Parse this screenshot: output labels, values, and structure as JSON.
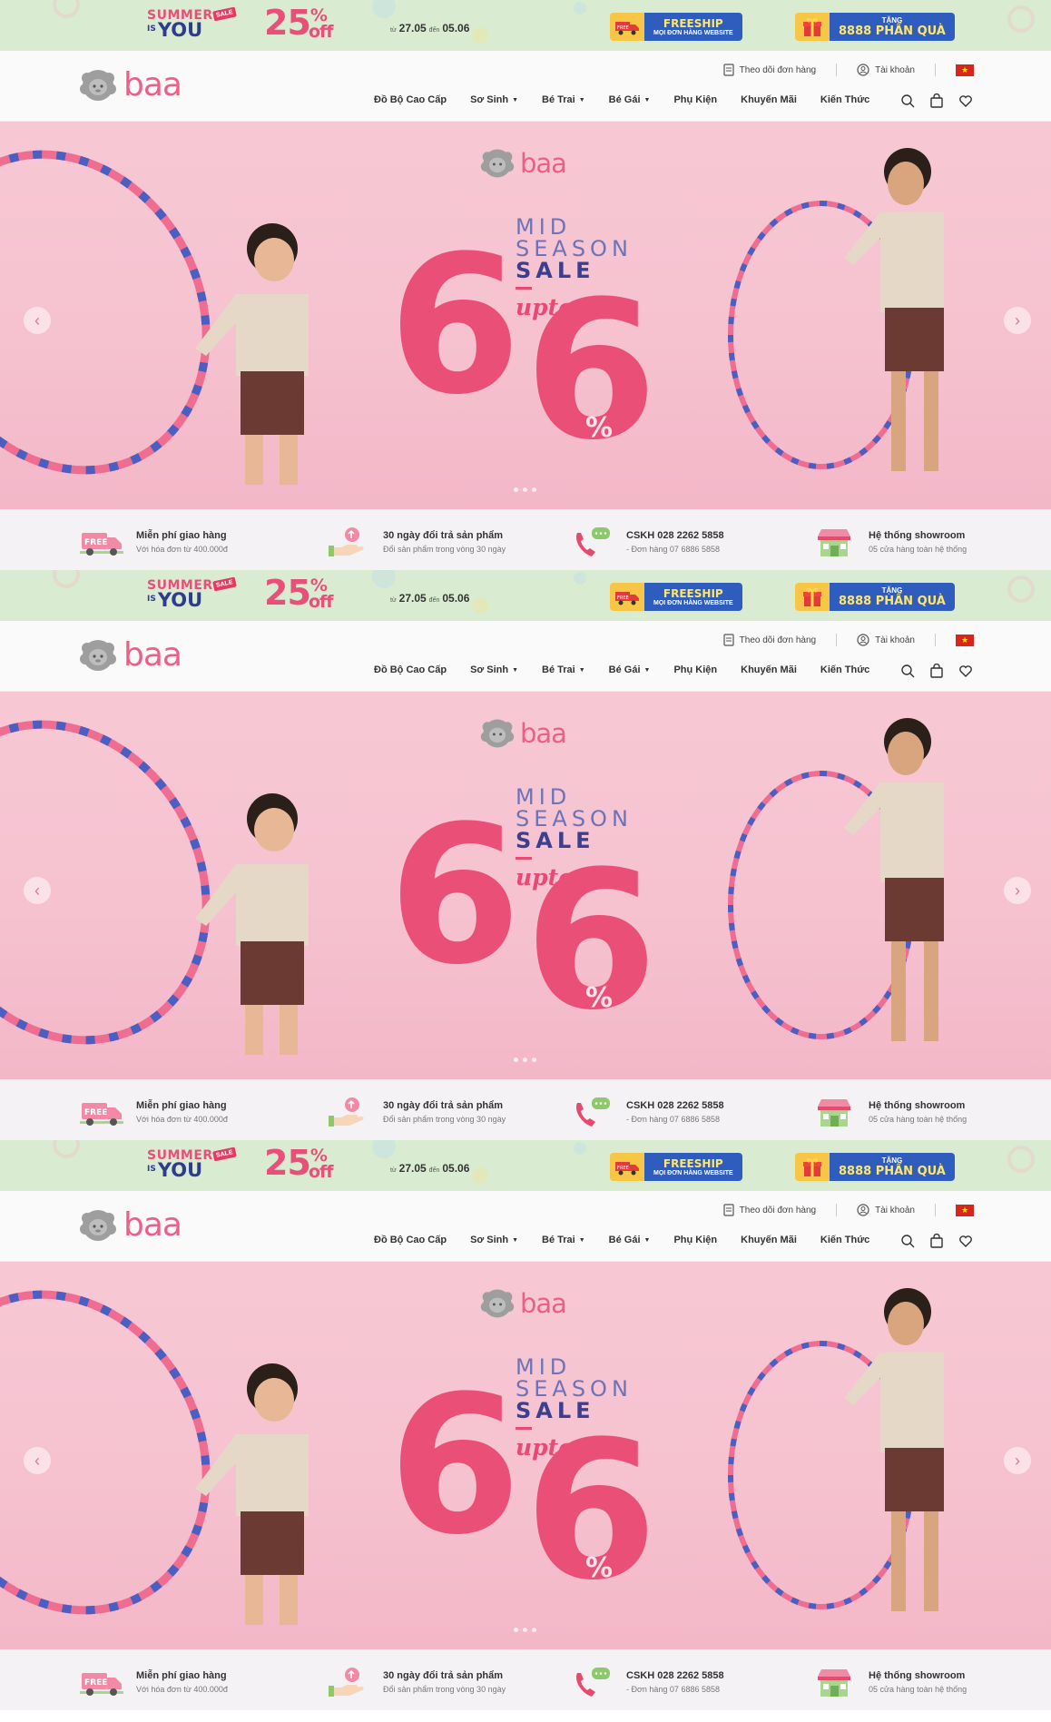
{
  "promo": {
    "summer": "SUMMER",
    "is": "IS",
    "you": "YOU",
    "sale_tag": "SALE",
    "percent": "25",
    "percent_sign": "%",
    "off": "off",
    "from_label": "từ",
    "from_date": "27.05",
    "to_label": "đến",
    "to_date": "05.06",
    "freeship_title": "FREESHIP",
    "freeship_sub": "MỌI ĐƠN HÀNG WEBSITE",
    "gift_top": "TẶNG",
    "gift_title": "8888 PHẦN QUÀ"
  },
  "header": {
    "logo_text": "baa",
    "track_order": "Theo dõi đơn hàng",
    "account": "Tài khoản",
    "language_flag": "flag-vietnam",
    "nav": [
      "Đồ Bộ Cao Cấp",
      "Sơ Sinh",
      "Bé Trai",
      "Bé Gái",
      "Phụ Kiện",
      "Khuyến Mãi",
      "Kiến Thức"
    ],
    "nav_has_caret": [
      false,
      true,
      true,
      true,
      false,
      false,
      false
    ]
  },
  "hero": {
    "logo_text": "baa",
    "line1": "MID",
    "line2": "SEASON",
    "line3": "SALE",
    "upto": "upto",
    "digit1": "6",
    "digit2": "6",
    "percent": "%",
    "slide_count": 3,
    "active_slide": 1
  },
  "features": [
    {
      "title": "Miễn phí giao hàng",
      "subtitle": "Với hóa đơn từ 400.000đ",
      "icon": "free-truck-icon",
      "icon_label": "FREE"
    },
    {
      "title": "30 ngày đổi trả sản phẩm",
      "subtitle": "Đổi sản phẩm trong vòng 30 ngày",
      "icon": "return-hand-icon"
    },
    {
      "title": "CSKH 028 2262 5858",
      "subtitle": "- Đơn hàng 07 6886 5858",
      "icon": "phone-chat-icon"
    },
    {
      "title": "Hệ thống showroom",
      "subtitle": "05 cửa hàng toàn hệ thống",
      "icon": "store-icon"
    }
  ],
  "colors": {
    "promo_bg": "#d9ecd2",
    "brand_pink": "#ec5f87",
    "hero_bg": "#f6c2d0",
    "navy": "#3c3f8f",
    "blue_badge": "#2f5dbd",
    "yellow": "#f8c646"
  }
}
